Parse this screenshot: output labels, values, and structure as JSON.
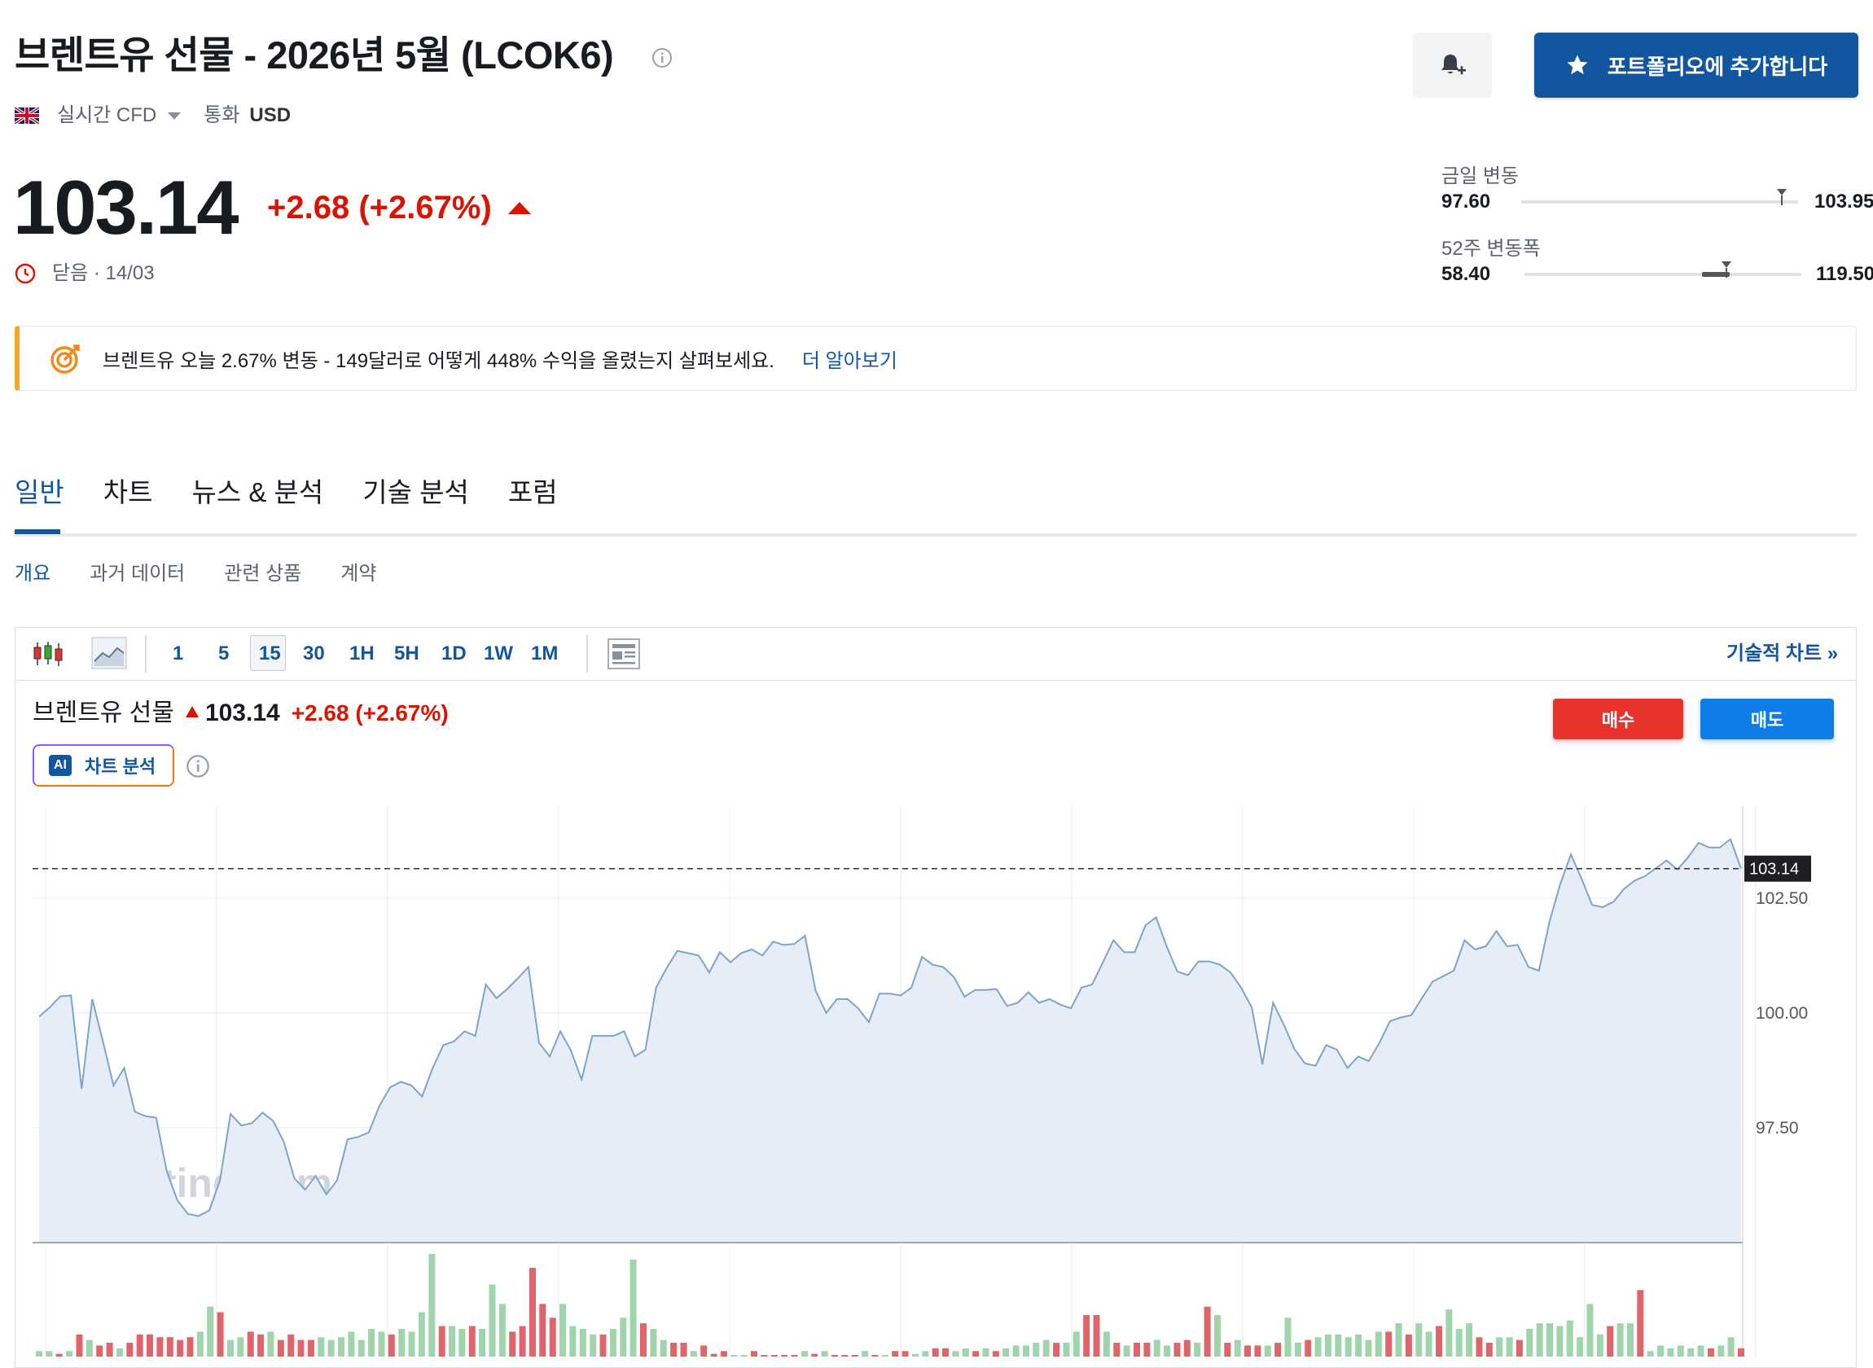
{
  "header": {
    "title": "브렌트유 선물 - 2026년 5월 (LCOK6)",
    "cfd_label": "실시간 CFD",
    "currency_label": "통화",
    "currency": "USD",
    "portfolio_button": "포트폴리오에 추가합니다"
  },
  "quote": {
    "price": "103.14",
    "change": "+2.68",
    "change_pct": "(+2.67%)",
    "status": "닫음 · 14/03",
    "colors": {
      "down_red": "#d91400",
      "brand_blue": "#1256a0"
    }
  },
  "ranges": {
    "day": {
      "label": "금일 변동",
      "low": "97.60",
      "high": "103.95",
      "position": 0.94
    },
    "week52": {
      "label": "52주 변동폭",
      "low": "58.40",
      "high": "119.50",
      "position": 0.73
    }
  },
  "banner": {
    "text": "브렌트유 오늘 2.67% 변동 - 149달러로 어떻게 448% 수익을 올렸는지 살펴보세요.",
    "link": "더 알아보기"
  },
  "tabs": [
    "일반",
    "차트",
    "뉴스 & 분석",
    "기술 분석",
    "포럼"
  ],
  "subtabs": [
    "개요",
    "과거 데이터",
    "관련 상품",
    "계약"
  ],
  "toolbar": {
    "intervals": [
      "1",
      "5",
      "15",
      "30",
      "1H",
      "5H",
      "1D",
      "1W",
      "1M"
    ],
    "active_interval": "15",
    "technical_link": "기술적 차트 »"
  },
  "chart_header": {
    "name": "브렌트유 선물",
    "price": "103.14",
    "change": "+2.68 (+2.67%)",
    "buy": "매수",
    "sell": "매도",
    "ai_badge": "AI",
    "ai_label": "차트 분석"
  },
  "chart_data": {
    "type": "area",
    "watermark": "Investing.com",
    "ylim": [
      95.0,
      104.5
    ],
    "yticks": [
      97.5,
      100.0,
      102.5
    ],
    "ytick_labels": [
      "97.50",
      "100.00",
      "102.50"
    ],
    "last_price": 103.14,
    "last_price_label": "103.14",
    "grid": true,
    "series": [
      {
        "values": [
          99.92,
          100.12,
          100.36,
          100.38,
          98.35,
          100.3,
          99.38,
          98.42,
          98.8,
          97.85,
          97.75,
          97.72,
          96.55,
          95.92,
          95.62,
          95.58,
          95.7,
          96.35,
          97.8,
          97.55,
          97.6,
          97.83,
          97.65,
          97.2,
          96.4,
          96.15,
          96.45,
          96.05,
          96.35,
          97.25,
          97.3,
          97.4,
          97.98,
          98.38,
          98.5,
          98.42,
          98.18,
          98.8,
          99.3,
          99.38,
          99.6,
          99.5,
          100.62,
          100.32,
          100.52,
          100.75,
          101.0,
          99.35,
          99.05,
          99.6,
          99.18,
          98.55,
          99.5,
          99.5,
          99.5,
          99.6,
          99.05,
          99.2,
          100.55,
          100.98,
          101.35,
          101.3,
          101.25,
          100.88,
          101.32,
          101.1,
          101.3,
          101.38,
          101.25,
          101.55,
          101.48,
          101.5,
          101.68,
          100.48,
          100.0,
          100.3,
          100.3,
          100.1,
          99.8,
          100.42,
          100.42,
          100.38,
          100.55,
          101.22,
          101.05,
          101.0,
          100.78,
          100.35,
          100.5,
          100.5,
          100.52,
          100.15,
          100.22,
          100.45,
          100.22,
          100.3,
          100.18,
          100.1,
          100.55,
          100.62,
          101.1,
          101.58,
          101.32,
          101.32,
          101.9,
          102.08,
          101.45,
          100.9,
          100.82,
          101.12,
          101.12,
          101.05,
          100.88,
          100.55,
          100.12,
          98.88,
          100.22,
          99.75,
          99.22,
          98.9,
          98.85,
          99.3,
          99.2,
          98.8,
          99.05,
          98.95,
          99.35,
          99.82,
          99.9,
          99.95,
          100.32,
          100.68,
          100.8,
          100.92,
          101.58,
          101.38,
          101.45,
          101.78,
          101.45,
          101.48,
          101.0,
          100.92,
          102.0,
          102.8,
          103.45,
          102.92,
          102.35,
          102.3,
          102.42,
          102.7,
          102.88,
          102.98,
          103.15,
          103.32,
          103.12,
          103.38,
          103.7,
          103.6,
          103.6,
          103.78,
          103.14
        ]
      }
    ],
    "volume": [
      2,
      2,
      1,
      2,
      8,
      6,
      4,
      5,
      3,
      5,
      8,
      8,
      7,
      7,
      6,
      7,
      9,
      18,
      16,
      6,
      7,
      9,
      8,
      9,
      6,
      8,
      6,
      6,
      7,
      6,
      7,
      9,
      6,
      10,
      9,
      8,
      10,
      9,
      16,
      37,
      11,
      11,
      10,
      11,
      10,
      26,
      19,
      9,
      11,
      32,
      19,
      14,
      19,
      11,
      10,
      8,
      8,
      10,
      14,
      35,
      12,
      10,
      6,
      5,
      5,
      2,
      4,
      1,
      2,
      0,
      0,
      2,
      0,
      0,
      0,
      0,
      2,
      1,
      2,
      0,
      0,
      0,
      2,
      0,
      0,
      2,
      2,
      1,
      2,
      3,
      3,
      2,
      3,
      2,
      3,
      2,
      3,
      4,
      4,
      5,
      6,
      5,
      5,
      9,
      15,
      15,
      9,
      5,
      4,
      5,
      5,
      6,
      4,
      5,
      6,
      5,
      18,
      15,
      5,
      6,
      4,
      4,
      4,
      5,
      14,
      5,
      6,
      7,
      8,
      8,
      7,
      8,
      6,
      9,
      9,
      12,
      8,
      12,
      9,
      11,
      17,
      10,
      12,
      7,
      5,
      7,
      7,
      6,
      10,
      12,
      12,
      11,
      13,
      7,
      19,
      8,
      11,
      12,
      12,
      24,
      2,
      4,
      3,
      4,
      3,
      4,
      3,
      4,
      7,
      3
    ],
    "volume_up": [
      true,
      true,
      false,
      true,
      false,
      true,
      false,
      false,
      true,
      false,
      false,
      false,
      false,
      false,
      false,
      false,
      true,
      true,
      false,
      true,
      true,
      false,
      false,
      true,
      false,
      false,
      false,
      false,
      true,
      true,
      true,
      true,
      true,
      true,
      true,
      false,
      true,
      true,
      true,
      true,
      false,
      true,
      true,
      false,
      true,
      true,
      true,
      false,
      false,
      false,
      false,
      false,
      true,
      true,
      true,
      true,
      false,
      true,
      true,
      true,
      false,
      true,
      true,
      false,
      false,
      true,
      false,
      false,
      false,
      true,
      true,
      false,
      false,
      false,
      false,
      false,
      true,
      false,
      true,
      false,
      false,
      false,
      true,
      false,
      true,
      false,
      false,
      true,
      true,
      false,
      false,
      true,
      true,
      false,
      true,
      false,
      true,
      true,
      true,
      true,
      true,
      false,
      true,
      true,
      false,
      false,
      true,
      false,
      true,
      false,
      false,
      true,
      true,
      false,
      false,
      true,
      false,
      true,
      false,
      true,
      false,
      false,
      true,
      false,
      true,
      true,
      false,
      true,
      true,
      true,
      true,
      true,
      true,
      true,
      false,
      true,
      false,
      true,
      true,
      false,
      true,
      true,
      true,
      false,
      false,
      true,
      true,
      false,
      true,
      true,
      true,
      true,
      true,
      true,
      true,
      true,
      false,
      true,
      true,
      false,
      true,
      true,
      true,
      true,
      true,
      true,
      false,
      true,
      true,
      false
    ]
  }
}
